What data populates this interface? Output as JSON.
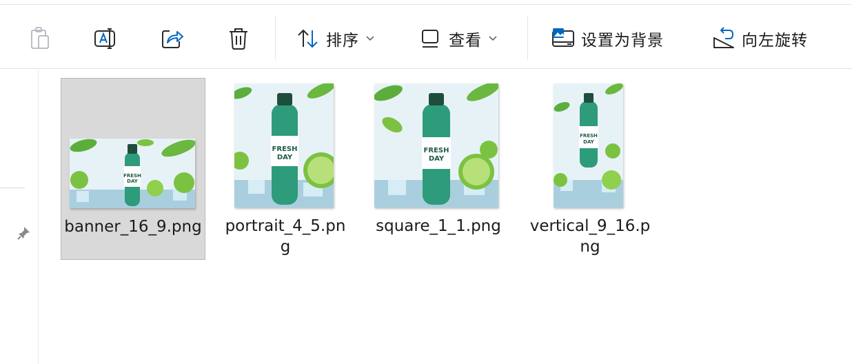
{
  "toolbar": {
    "copy_icon": "clipboard-icon",
    "rename_icon": "rename-icon",
    "share_icon": "share-icon",
    "delete_icon": "trash-icon",
    "sort_label": "排序",
    "view_label": "查看",
    "set_background_label": "设置为背景",
    "rotate_left_label": "向左旋转"
  },
  "files": [
    {
      "name": "banner_16_9.png",
      "selected": true
    },
    {
      "name": "portrait_4_5.png",
      "selected": false
    },
    {
      "name": "square_1_1.png",
      "selected": false
    },
    {
      "name": "vertical_9_16.png",
      "selected": false
    }
  ],
  "thumbnail": {
    "brand_line1": "FRESH",
    "brand_line2": "DAY"
  },
  "colors": {
    "accent": "#0067c0",
    "selection": "#d9d9d9",
    "bottle": "#2e9b7a",
    "lime": "#7cc242"
  }
}
